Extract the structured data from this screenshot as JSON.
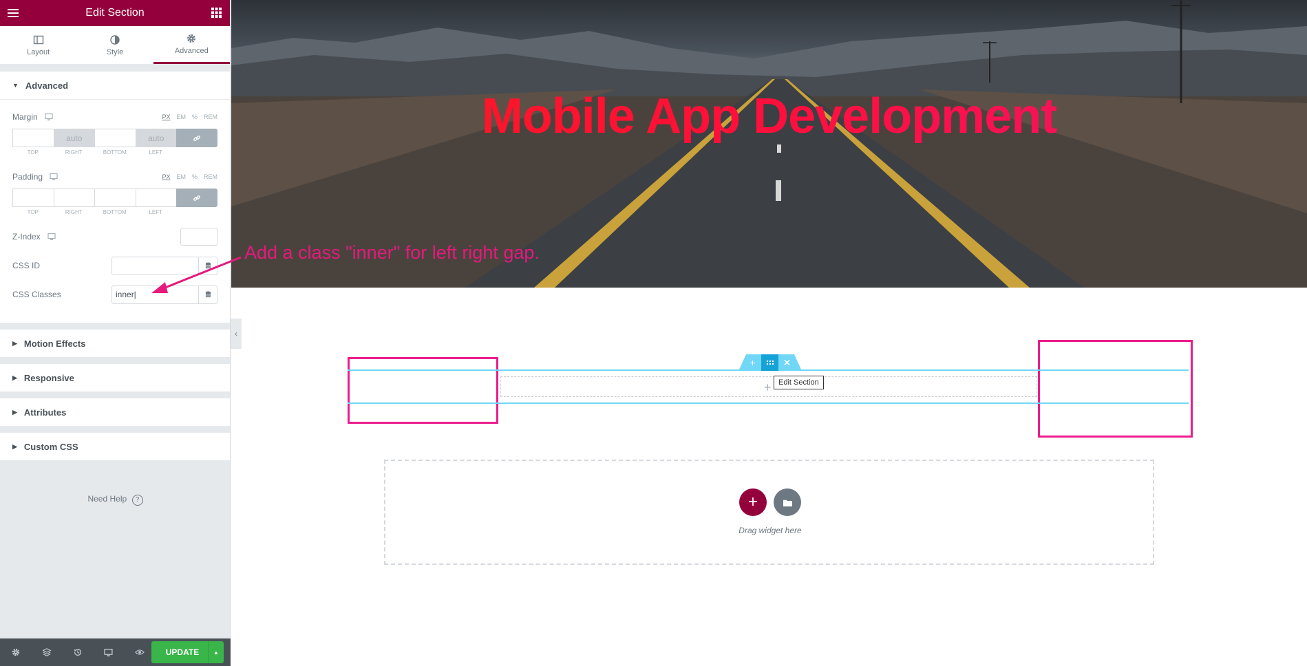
{
  "panel": {
    "title": "Edit Section",
    "tabs": [
      {
        "label": "Layout",
        "icon": "layout-icon"
      },
      {
        "label": "Style",
        "icon": "half-circle-icon"
      },
      {
        "label": "Advanced",
        "icon": "gear-icon",
        "active": true
      }
    ],
    "advanced": {
      "heading": "Advanced",
      "margin": {
        "label": "Margin",
        "units": [
          "PX",
          "EM",
          "%",
          "REM"
        ],
        "active_unit": "PX",
        "values": {
          "top": "",
          "right": "auto",
          "bottom": "",
          "left": "auto"
        },
        "sublabels": [
          "TOP",
          "RIGHT",
          "BOTTOM",
          "LEFT"
        ]
      },
      "padding": {
        "label": "Padding",
        "units": [
          "PX",
          "EM",
          "%",
          "REM"
        ],
        "active_unit": "PX",
        "values": {
          "top": "",
          "right": "",
          "bottom": "",
          "left": ""
        },
        "sublabels": [
          "TOP",
          "RIGHT",
          "BOTTOM",
          "LEFT"
        ]
      },
      "z_index": {
        "label": "Z-Index",
        "value": ""
      },
      "css_id": {
        "label": "CSS ID",
        "value": ""
      },
      "css_classes": {
        "label": "CSS Classes",
        "value": "inner|"
      }
    },
    "sections": [
      "Motion Effects",
      "Responsive",
      "Attributes",
      "Custom CSS"
    ],
    "need_help": "Need Help",
    "footer": {
      "update_label": "UPDATE"
    }
  },
  "preview": {
    "hero_title": "Mobile App Development",
    "annotation": "Add a class \"inner\" for left right gap.",
    "tooltip": "Edit Section",
    "drag_text": "Drag widget here"
  },
  "colors": {
    "brand": "#93003c",
    "update_green": "#39b54a",
    "section_blue": "#71d7f7",
    "highlight_pink": "#ec1c8c",
    "hero_title": "#ff1a3a"
  }
}
